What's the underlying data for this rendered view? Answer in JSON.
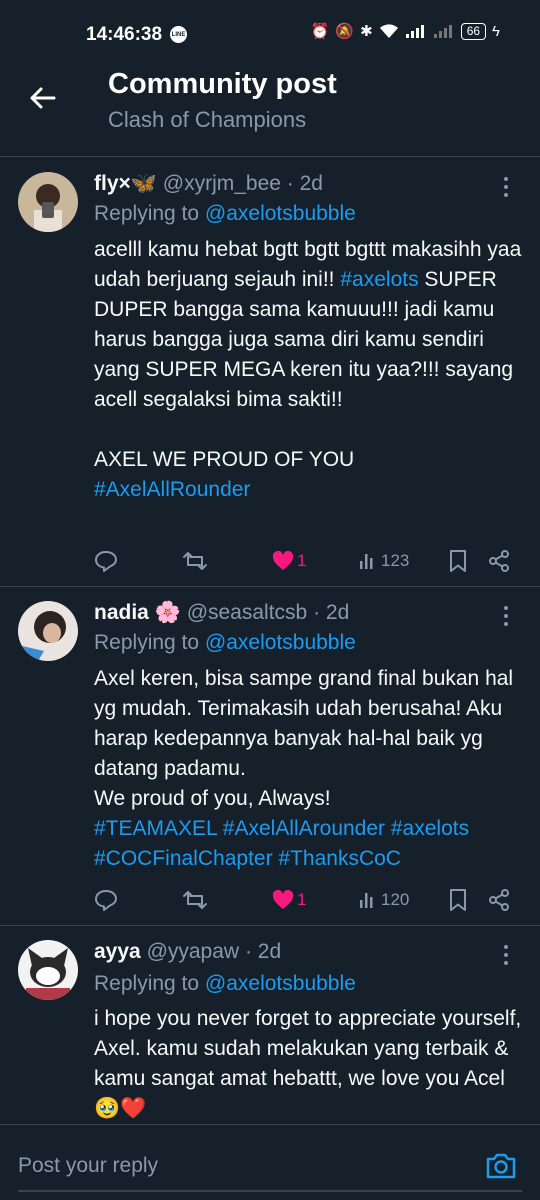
{
  "status_bar": {
    "time": "14:46:38",
    "line_badge": "LINE",
    "battery": "66"
  },
  "header": {
    "title": "Community post",
    "subtitle": "Clash of Champions"
  },
  "posts": [
    {
      "name": "fly×🦋",
      "handle": "@xyrjm_bee",
      "time": "· 2d",
      "replying_prefix": "Replying to ",
      "replying_to": "@axelotsbubble",
      "body": [
        {
          "t": "acelll kamu hebat bgtt bgtt bgttt makasihh yaa udah berjuang sejauh ini!! "
        },
        {
          "t": "#axelots",
          "tag": true
        },
        {
          "t": " SUPER DUPER bangga sama kamuuu!!! jadi kamu harus bangga juga sama diri kamu sendiri yang SUPER MEGA keren itu yaa?!!! sayang acell segalaksi bima sakti!!\n\nAXEL WE PROUD OF YOU\n"
        },
        {
          "t": "#AxelAllRounder",
          "tag": true
        }
      ],
      "likes": "1",
      "views": "123"
    },
    {
      "name": "nadia 🌸",
      "handle": "@seasaltcsb",
      "time": "· 2d",
      "replying_prefix": "Replying to ",
      "replying_to": "@axelotsbubble",
      "body": [
        {
          "t": "Axel keren, bisa sampe grand final bukan hal yg mudah. Terimakasih udah berusaha! Aku harap kedepannya banyak hal-hal baik yg datang padamu.\nWe proud of you, Always!\n"
        },
        {
          "t": "#TEAMAXEL #AxelAllArounder #axelots #COCFinalChapter #ThanksCoC",
          "tag": true
        }
      ],
      "likes": "1",
      "views": "120"
    },
    {
      "name": "ayya",
      "handle": "@yyapaw",
      "time": "· 2d",
      "replying_prefix": "Replying to ",
      "replying_to": "@axelotsbubble",
      "body": [
        {
          "t": "i hope you never forget to appreciate yourself, Axel. kamu sudah melakukan yang terbaik & kamu sangat amat hebattt, we love you Acel 🥹❤️"
        }
      ]
    }
  ],
  "composer": {
    "placeholder": "Post your reply"
  },
  "icons": {
    "back": "arrow-left-icon",
    "more": "more-vertical-icon",
    "reply": "reply-icon",
    "repost": "repost-icon",
    "like": "heart-icon",
    "views": "views-icon",
    "bookmark": "bookmark-icon",
    "share": "share-icon",
    "camera": "camera-icon"
  },
  "colors": {
    "background": "#15202b",
    "accent": "#1d9bf0",
    "like": "#f91880",
    "muted": "#8b98a5"
  }
}
